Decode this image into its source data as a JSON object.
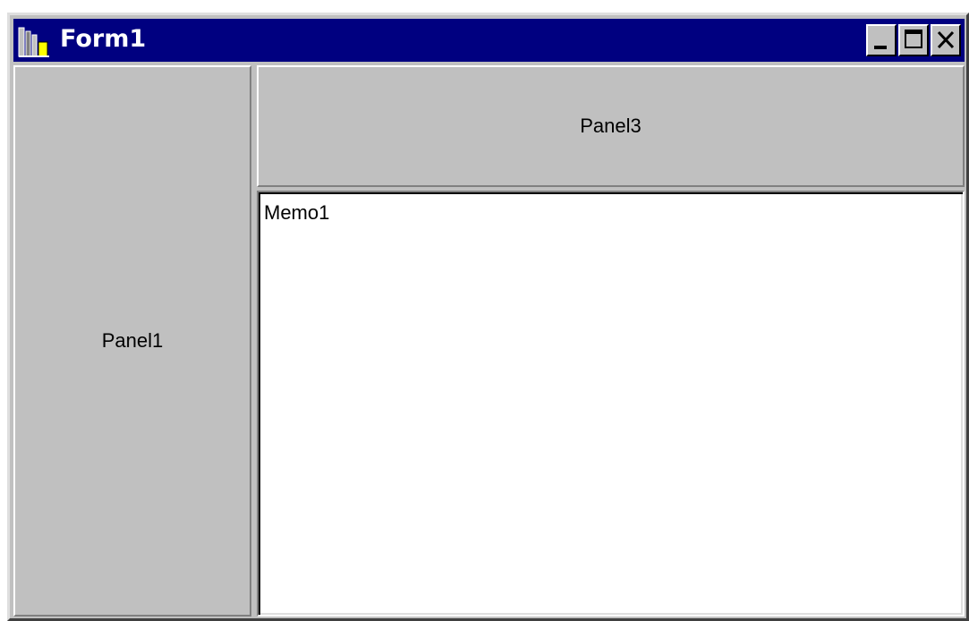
{
  "window": {
    "title": "Form1",
    "minimize_label": "_",
    "maximize_label": "□",
    "close_label": "×"
  },
  "panels": {
    "panel1_caption": "Panel1",
    "panel3_caption": "Panel3"
  },
  "memo": {
    "text": "Memo1"
  },
  "icons": {
    "app": "delphi-app-icon",
    "minimize": "minimize-icon",
    "maximize": "maximize-icon",
    "close": "close-icon"
  },
  "colors": {
    "titlebar": "#000080",
    "face": "#c0c0c0",
    "memo_bg": "#ffffff"
  }
}
